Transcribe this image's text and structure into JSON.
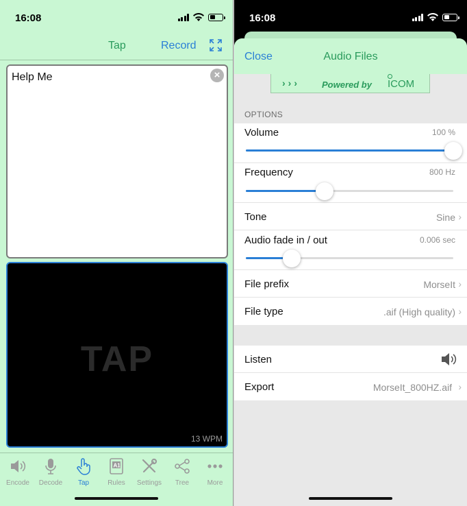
{
  "left": {
    "status": {
      "time": "16:08"
    },
    "toolbar": {
      "tap_label": "Tap",
      "record_label": "Record"
    },
    "message": {
      "text": "Help Me"
    },
    "tap_pad": {
      "watermark": "TAP",
      "speed": "13 WPM"
    },
    "tabs": [
      {
        "label": "Encode",
        "icon": "speaker-icon"
      },
      {
        "label": "Decode",
        "icon": "microphone-icon"
      },
      {
        "label": "Tap",
        "icon": "hand-pointer-icon",
        "active": true
      },
      {
        "label": "Rules",
        "icon": "rules-icon"
      },
      {
        "label": "Settings",
        "icon": "tools-icon"
      },
      {
        "label": "Tree",
        "icon": "tree-icon"
      },
      {
        "label": "More",
        "icon": "ellipsis-icon"
      }
    ]
  },
  "right": {
    "status": {
      "time": "16:08"
    },
    "header": {
      "close_label": "Close",
      "title": "Audio Files"
    },
    "banner": {
      "chevrons": "›››",
      "powered_by": "Powered by",
      "brand": "ICOM"
    },
    "options_header": "OPTIONS",
    "options": {
      "volume": {
        "label": "Volume",
        "value": "100 %",
        "level": 1.0
      },
      "frequency": {
        "label": "Frequency",
        "value": "800 Hz",
        "level": 0.38
      },
      "tone": {
        "label": "Tone",
        "value": "Sine"
      },
      "fade": {
        "label": "Audio fade in / out",
        "value": "0.006 sec",
        "level": 0.22
      },
      "prefix": {
        "label": "File prefix",
        "value": "MorseIt"
      },
      "filetype": {
        "label": "File type",
        "value": ".aif (High quality)"
      }
    },
    "actions": {
      "listen": {
        "label": "Listen",
        "icon": "speaker-icon"
      },
      "export": {
        "label": "Export",
        "value": "MorseIt_800HZ.aif"
      }
    }
  },
  "colors": {
    "accent_blue": "#2a7fd6",
    "accent_green": "#2a9b5c",
    "mint_background": "#c9f7d3"
  }
}
